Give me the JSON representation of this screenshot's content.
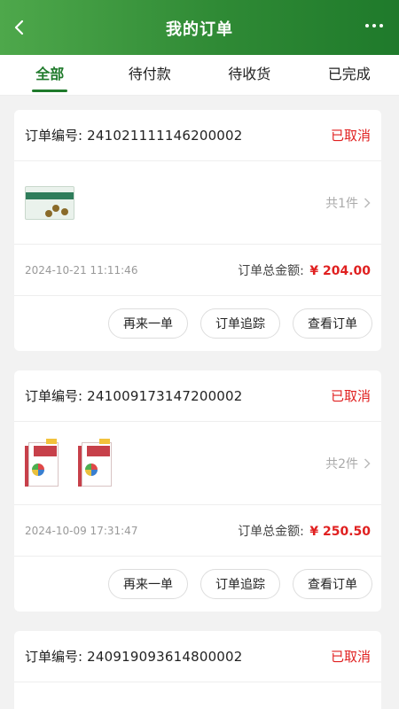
{
  "header": {
    "title": "我的订单"
  },
  "tabs": [
    "全部",
    "待付款",
    "待收货",
    "已完成"
  ],
  "orders": [
    {
      "label": "订单编号:",
      "number": "241021111146200002",
      "status": "已取消",
      "item_count": "共1件",
      "time": "2024-10-21 11:11:46",
      "total_label": "订单总金额:",
      "amount": "¥ 204.00",
      "actions": [
        "再来一单",
        "订单追踪",
        "查看订单"
      ]
    },
    {
      "label": "订单编号:",
      "number": "241009173147200002",
      "status": "已取消",
      "item_count": "共2件",
      "time": "2024-10-09 17:31:47",
      "total_label": "订单总金额:",
      "amount": "¥ 250.50",
      "actions": [
        "再来一单",
        "订单追踪",
        "查看订单"
      ]
    },
    {
      "label": "订单编号:",
      "number": "240919093614800002",
      "status": "已取消"
    }
  ],
  "colors": {
    "brand_green": "#1f7a2b",
    "status_red": "#e02020"
  }
}
